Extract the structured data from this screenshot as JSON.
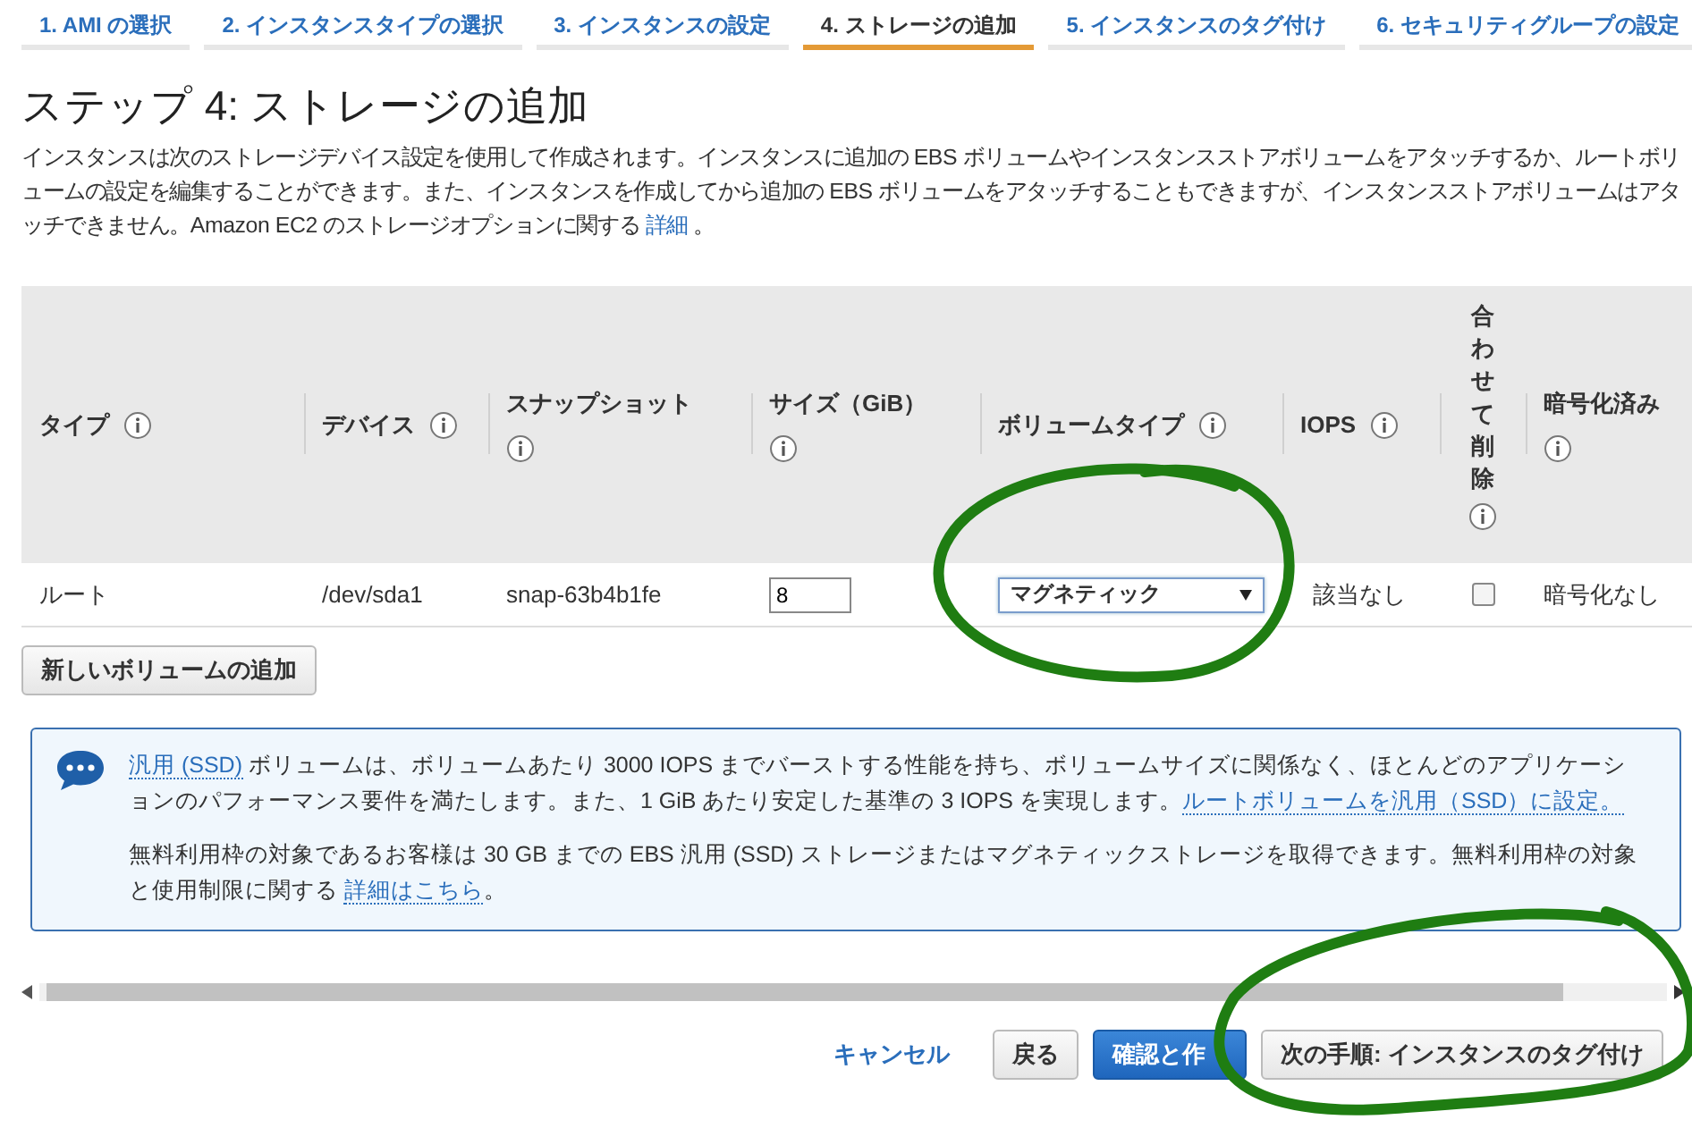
{
  "tabs": [
    {
      "label": "1. AMI の選択",
      "selected": false
    },
    {
      "label": "2. インスタンスタイプの選択",
      "selected": false
    },
    {
      "label": "3. インスタンスの設定",
      "selected": false
    },
    {
      "label": "4. ストレージの追加",
      "selected": true
    },
    {
      "label": "5. インスタンスのタグ付け",
      "selected": false
    },
    {
      "label": "6. セキュリティグループの設定",
      "selected": false
    }
  ],
  "title": "ステップ 4: ストレージの追加",
  "description": {
    "text": "インスタンスは次のストレージデバイス設定を使用して作成されます。インスタンスに追加の EBS ボリュームやインスタンスストアボリュームをアタッチするか、ルートボリュームの設定を編集することができます。また、インスタンスを作成してから追加の EBS ボリュームをアタッチすることもできますが、インスタンスストアボリュームはアタッチできません。Amazon EC2 のストレージオプションに関する ",
    "link": "詳細",
    "suffix": " 。"
  },
  "table": {
    "columns": [
      {
        "label": "タイプ",
        "kind": "normal"
      },
      {
        "label": "デバイス",
        "kind": "normal"
      },
      {
        "label": "スナップショット",
        "kind": "normal"
      },
      {
        "label": "サイズ（GiB）",
        "kind": "normal"
      },
      {
        "label": "ボリュームタイプ",
        "kind": "normal"
      },
      {
        "label": "IOPS",
        "kind": "normal"
      },
      {
        "label": "合わせて削除",
        "kind": "vertical"
      },
      {
        "label": "暗号化済み",
        "kind": "normal"
      }
    ],
    "rows": [
      {
        "type": "ルート",
        "device": "/dev/sda1",
        "snapshot": "snap-63b4b1fe",
        "size": "8",
        "volume_type": "マグネティック",
        "iops": "該当なし",
        "delete_on_termination": false,
        "encryption": "暗号化なし"
      }
    ]
  },
  "add_volume_button": "新しいボリュームの追加",
  "info": {
    "p1_link": "汎用 (SSD)",
    "p1_text": " ボリュームは、ボリュームあたり 3000 IOPS までバーストする性能を持ち、ボリュームサイズに関係なく、ほとんどのアプリケーションのパフォーマンス要件を満たします。また、1 GiB あたり安定した基準の 3 IOPS を実現します。",
    "p1_action": "ルートボリュームを汎用（SSD）に設定。",
    "p2_text": "無料利用枠の対象であるお客様は 30 GB までの EBS 汎用 (SSD) ストレージまたはマグネティックストレージを取得できます。無料利用枠の対象と使用制限に関する ",
    "p2_link": "詳細はこちら",
    "p2_suffix": "。"
  },
  "footer": {
    "cancel": "キャンセル",
    "back": "戻る",
    "review": "確認と作",
    "next": "次の手順: インスタンスのタグ付け"
  },
  "annotations": [
    {
      "kind": "loop"
    },
    {
      "kind": "loop"
    }
  ]
}
